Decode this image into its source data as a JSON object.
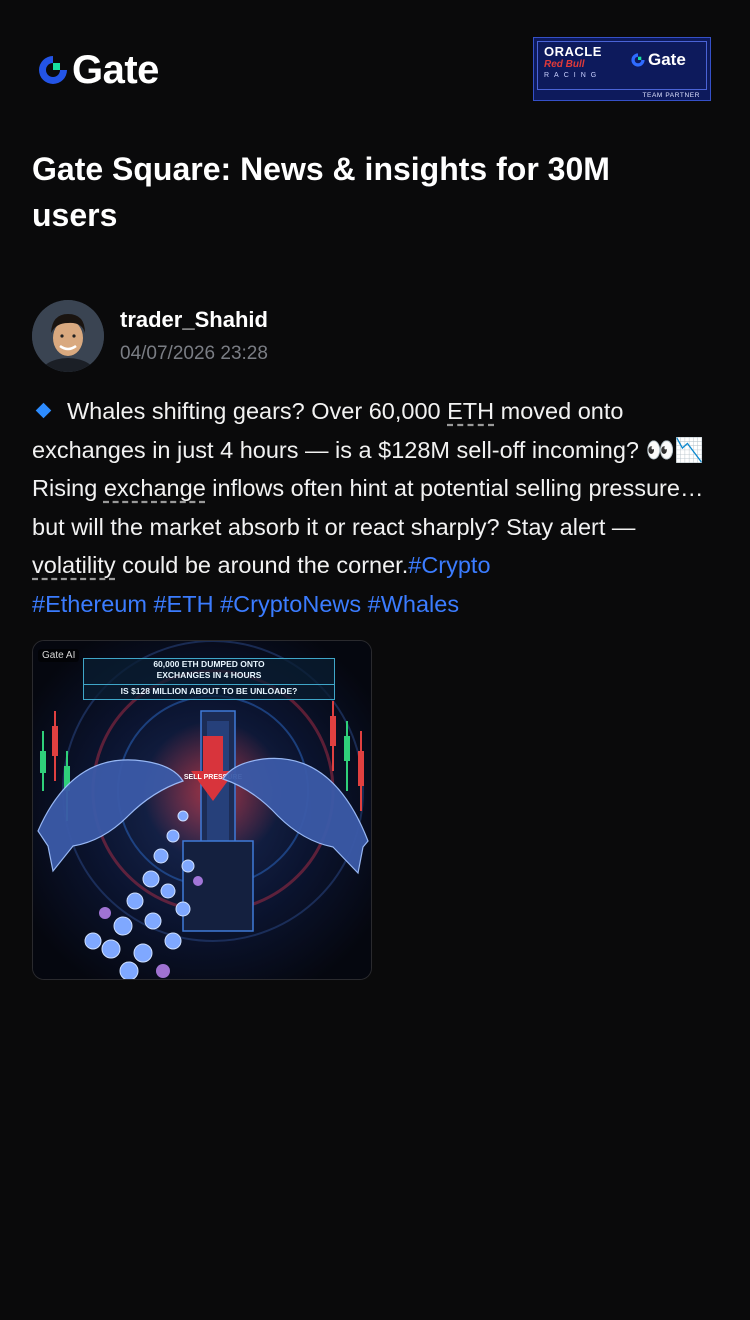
{
  "brand": {
    "name": "Gate",
    "accent": "#2354e6",
    "green": "#17e0a0"
  },
  "partner_badge": {
    "oracle": "ORACLE",
    "redbull": "Red Bull",
    "racing": "RACING",
    "gate": "Gate",
    "team_partner": "TEAM PARTNER"
  },
  "headline": "Gate Square: News & insights for 30M users",
  "post": {
    "author": "trader_Shahid",
    "timestamp": "04/07/2026 23:28",
    "text_1": "Whales shifting gears? Over 60,000 ",
    "link_eth": "ETH",
    "text_2": " moved onto exchanges in just 4 hours — is a $128M sell-off incoming? 👀📉Rising ",
    "link_exchange": "exchange",
    "text_3": " inflows often hint at potential selling pressure… but will the market absorb it or react sharply? Stay alert — ",
    "link_volatility": "volatility",
    "text_4": " could be around the corner.",
    "hashtags": [
      "#Crypto",
      "#Ethereum",
      "#ETH",
      "#CryptoNews",
      "#Whales"
    ],
    "image": {
      "ai_label": "Gate AI",
      "banner_line_1": "60,000 ETH DUMPED ONTO",
      "banner_line_2": "EXCHANGES IN 4 HOURS",
      "banner_line_3": "IS $128 MILLION ABOUT TO BE UNLOADE?",
      "sign_text": "SELL PRESSURE"
    }
  }
}
